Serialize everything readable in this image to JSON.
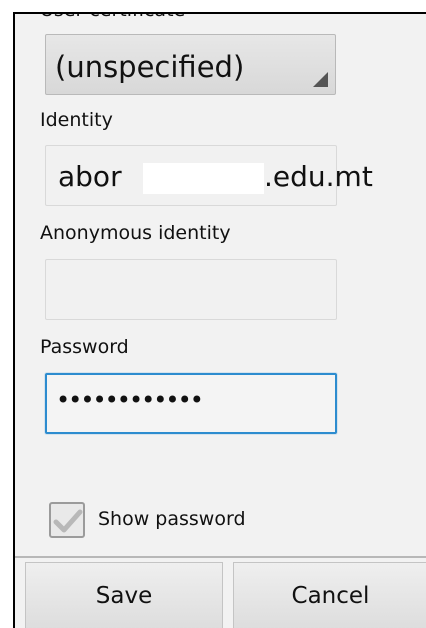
{
  "form": {
    "user_certificate_label": "User certificate",
    "user_certificate_value": "(unspecified)",
    "identity_label": "Identity",
    "identity_value_prefix": "abor",
    "identity_value_suffix": ".edu.mt",
    "anonymous_identity_label": "Anonymous identity",
    "anonymous_identity_value": "",
    "password_label": "Password",
    "password_value": "••••••••••••",
    "show_password_label": "Show password",
    "show_password_checked": true
  },
  "actions": {
    "save_label": "Save",
    "cancel_label": "Cancel"
  },
  "icons": {
    "spinner_arrow": "dropdown-corner-icon",
    "checkbox_mark": "check-icon"
  },
  "colors": {
    "focused_field_border": "#2d8ccf",
    "panel_background": "#f2f2f2"
  }
}
